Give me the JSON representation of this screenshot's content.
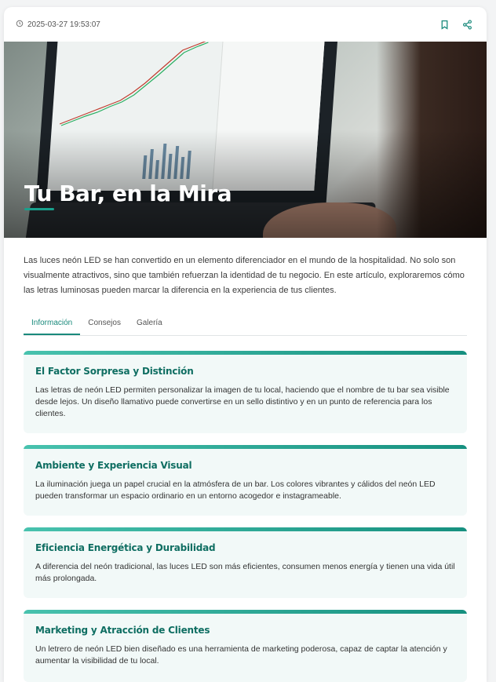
{
  "header": {
    "timestamp": "2025-03-27 19:53:07"
  },
  "hero": {
    "title": "Tu Bar, en la Mira"
  },
  "intro": "Las luces neón LED se han convertido en un elemento diferenciador en el mundo de la hospitalidad. No solo son visualmente atractivos, sino que también refuerzan la identidad de tu negocio. En este artículo, exploraremos cómo las letras luminosas pueden marcar la diferencia en la experiencia de tus clientes.",
  "tabs": [
    {
      "label": "Información",
      "active": true
    },
    {
      "label": "Consejos",
      "active": false
    },
    {
      "label": "Galería",
      "active": false
    }
  ],
  "sections": [
    {
      "title": "El Factor Sorpresa y Distinción",
      "body": "Las letras de neón LED permiten personalizar la imagen de tu local, haciendo que el nombre de tu bar sea visible desde lejos. Un diseño llamativo puede convertirse en un sello distintivo y en un punto de referencia para los clientes."
    },
    {
      "title": "Ambiente y Experiencia Visual",
      "body": "La iluminación juega un papel crucial en la atmósfera de un bar. Los colores vibrantes y cálidos del neón LED pueden transformar un espacio ordinario en un entorno acogedor e instagrameable."
    },
    {
      "title": "Eficiencia Energética y Durabilidad",
      "body": "A diferencia del neón tradicional, las luces LED son más eficientes, consumen menos energía y tienen una vida útil más prolongada."
    },
    {
      "title": "Marketing y Atracción de Clientes",
      "body": "Un letrero de neón LED bien diseñado es una herramienta de marketing poderosa, capaz de captar la atención y aumentar la visibilidad de tu local."
    }
  ],
  "icons": {
    "clock": "clock-icon",
    "bookmark": "bookmark-icon",
    "share": "share-icon"
  },
  "colors": {
    "accent": "#1a8a7c",
    "section_title": "#0f6e62",
    "section_bg": "#f2f9f8"
  }
}
